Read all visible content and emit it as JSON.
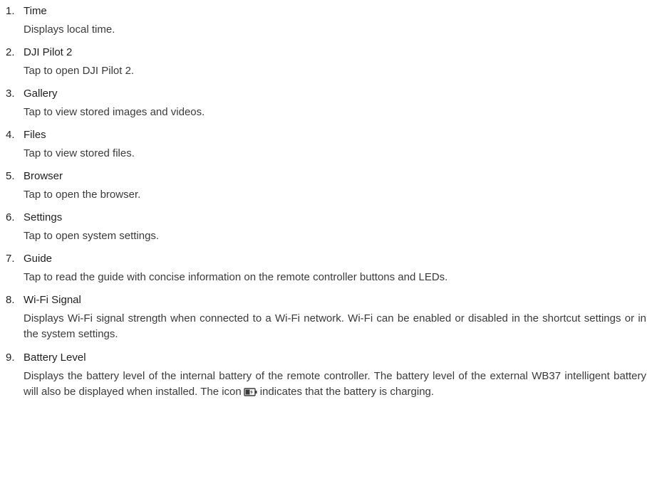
{
  "items": [
    {
      "num": "1.",
      "title": "Time",
      "desc": "Displays local time."
    },
    {
      "num": "2.",
      "title": "DJI Pilot 2",
      "desc": "Tap to open DJI Pilot 2."
    },
    {
      "num": "3.",
      "title": "Gallery",
      "desc": "Tap to view stored images and videos."
    },
    {
      "num": "4.",
      "title": "Files",
      "desc": "Tap to view stored files."
    },
    {
      "num": "5.",
      "title": "Browser",
      "desc": "Tap to open the browser."
    },
    {
      "num": "6.",
      "title": "Settings",
      "desc": "Tap to open system settings."
    },
    {
      "num": "7.",
      "title": "Guide",
      "desc": "Tap to read the guide with concise information on the remote controller buttons and LEDs."
    },
    {
      "num": "8.",
      "title": "Wi-Fi Signal",
      "desc": "Displays Wi-Fi signal strength when connected to a Wi-Fi network. Wi-Fi can be enabled or disabled in the shortcut settings or in the system settings."
    },
    {
      "num": "9.",
      "title": "Battery Level",
      "desc_before_icon": "Displays the battery level of the internal battery of the remote controller. The battery level of the external WB37 intelligent battery will also be displayed when installed. The icon",
      "desc_after_icon": "indicates that the battery is charging.",
      "icon": "battery-charging-icon"
    }
  ]
}
